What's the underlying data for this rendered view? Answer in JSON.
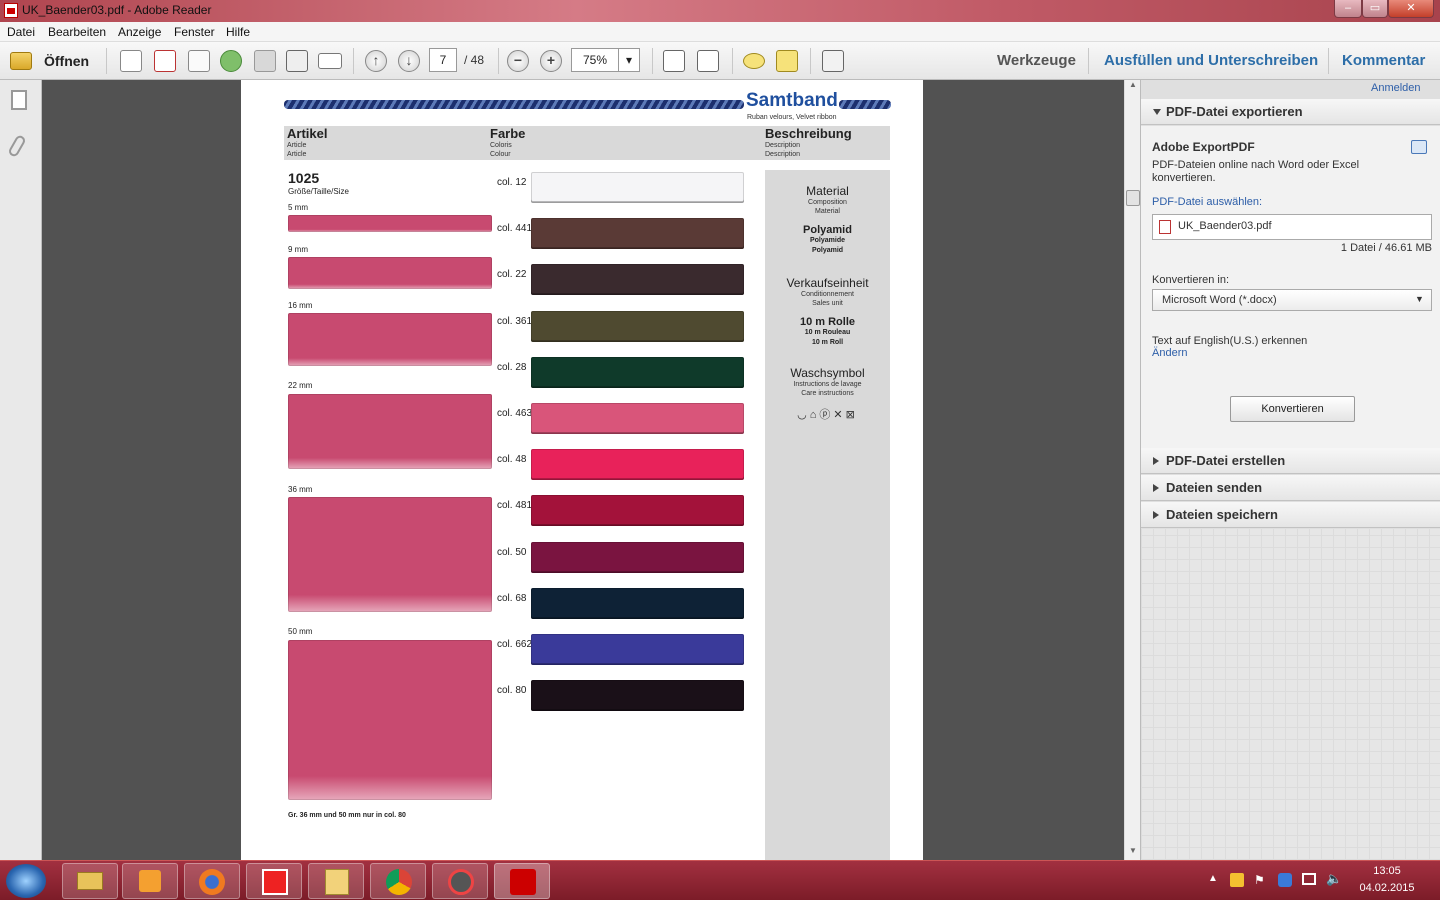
{
  "window": {
    "title": "UK_Baender03.pdf - Adobe Reader"
  },
  "menu": [
    "Datei",
    "Bearbeiten",
    "Anzeige",
    "Fenster",
    "Hilfe"
  ],
  "toolbar": {
    "open_label": "Öffnen",
    "page_current": "7",
    "page_total": "/ 48",
    "zoom": "75%",
    "tools": "Werkzeuge",
    "fill_sign": "Ausfüllen und Unterschreiben",
    "comment": "Kommentar"
  },
  "doc": {
    "brand": "Samtband",
    "brand_sub": "Ruban velours, Velvet ribbon",
    "col_article": "Artikel",
    "col_article_sub1": "Article",
    "col_article_sub2": "Article",
    "col_color": "Farbe",
    "col_color_sub1": "Coloris",
    "col_color_sub2": "Colour",
    "col_desc": "Beschreibung",
    "col_desc_sub1": "Description",
    "col_desc_sub2": "Description",
    "article_no": "1025",
    "size_label": "Größe/Taille/Size",
    "sizes": [
      "5 mm",
      "9 mm",
      "16 mm",
      "22 mm",
      "36 mm",
      "50 mm"
    ],
    "colors": [
      "col. 12",
      "col. 441",
      "col. 22",
      "col. 361",
      "col. 28",
      "col. 463",
      "col. 48",
      "col. 481",
      "col. 50",
      "col. 68",
      "col. 662",
      "col. 80"
    ],
    "color_hex": [
      "#f5f5f7",
      "#5a3a36",
      "#3a2a2e",
      "#4f4a30",
      "#0f3a2a",
      "#d9557a",
      "#e8225a",
      "#a3123a",
      "#7a1440",
      "#0e2236",
      "#3a3a9a",
      "#1a1018"
    ],
    "ribbon_hex": "#c84a70",
    "footnote": "Gr. 36 mm und 50 mm nur in col. 80",
    "desc": {
      "material": "Material",
      "material_s1": "Composition",
      "material_s2": "Material",
      "polyamid": "Polyamid",
      "polyamid_s1": "Polyamide",
      "polyamid_s2": "Polyamid",
      "unit": "Verkaufseinheit",
      "unit_s1": "Conditionnement",
      "unit_s2": "Sales unit",
      "roll": "10 m Rolle",
      "roll_s1": "10 m Rouleau",
      "roll_s2": "10 m Roll",
      "wash": "Waschsymbol",
      "wash_s1": "Instructions de lavage",
      "wash_s2": "Care instructions"
    }
  },
  "rightpane": {
    "login": "Anmelden",
    "export_header": "PDF-Datei exportieren",
    "service": "Adobe ExportPDF",
    "service_desc": "PDF-Dateien online nach Word oder Excel konvertieren.",
    "select_label": "PDF-Datei auswählen:",
    "file": "UK_Baender03.pdf",
    "file_info": "1 Datei / 46.61 MB",
    "convert_to": "Konvertieren in:",
    "format": "Microsoft Word (*.docx)",
    "ocr_text": "Text auf English(U.S.) erkennen",
    "change": "Ändern",
    "convert_btn": "Konvertieren",
    "sections": [
      "PDF-Datei erstellen",
      "Dateien senden",
      "Dateien speichern"
    ]
  },
  "taskbar": {
    "time": "13:05",
    "date": "04.02.2015"
  }
}
